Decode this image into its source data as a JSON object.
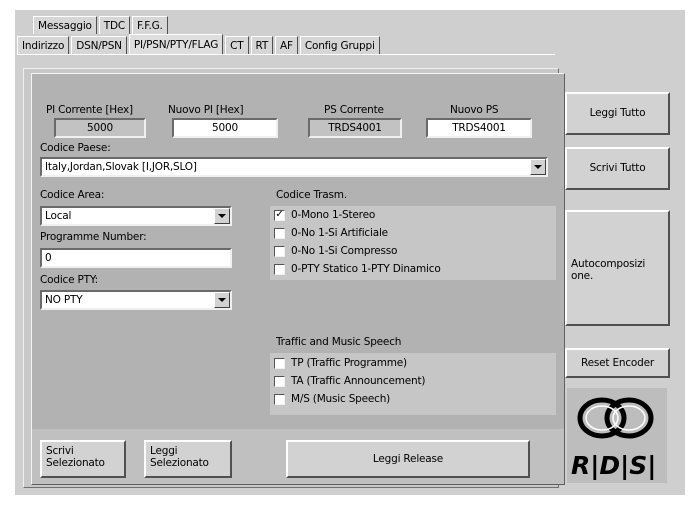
{
  "tabs_row1": [
    {
      "label": "Messaggio",
      "active": false
    },
    {
      "label": "TDC",
      "active": false
    },
    {
      "label": "F.F.G.",
      "active": false
    }
  ],
  "tabs_row2": [
    {
      "label": "Indirizzo",
      "active": false
    },
    {
      "label": "DSN/PSN",
      "active": false
    },
    {
      "label": "PI/PSN/PTY/FLAG",
      "active": true
    },
    {
      "label": "CT",
      "active": false
    },
    {
      "label": "RT",
      "active": false
    },
    {
      "label": "AF",
      "active": false
    },
    {
      "label": "Config Gruppi",
      "active": false
    }
  ],
  "pi_corrente": {
    "label": "PI Corrente [Hex]",
    "value": "5000"
  },
  "nuovo_pi": {
    "label": "Nuovo PI [Hex]",
    "value": "5000"
  },
  "ps_corrente": {
    "label": "PS Corrente",
    "value": "TRDS4001"
  },
  "nuovo_ps": {
    "label": "Nuovo PS",
    "value": "TRDS4001"
  },
  "codice_paese": {
    "label": "Codice Paese:",
    "value": "Italy,Jordan,Slovak [I,JOR,SLO]"
  },
  "codice_area": {
    "label": "Codice Area:",
    "value": "Local"
  },
  "program_number": {
    "label": "Programme Number:",
    "value": "0"
  },
  "codice_pty": {
    "label": "Codice PTY:",
    "value": "NO PTY"
  },
  "codice_trasm": {
    "label": "Codice Trasm.",
    "items": [
      {
        "label": "0-Mono 1-Stereo",
        "checked": true,
        "mark": "✓"
      },
      {
        "label": "0-No 1-Si Artificiale",
        "checked": false,
        "mark": ""
      },
      {
        "label": "0-No 1-Si Compresso",
        "checked": false,
        "mark": ""
      },
      {
        "label": "0-PTY Statico 1-PTY Dinamico",
        "checked": false,
        "mark": ""
      }
    ]
  },
  "traffic": {
    "label": "Traffic and Music Speech",
    "items": [
      {
        "label": "TP (Traffic Programme)",
        "checked": false,
        "mark": ""
      },
      {
        "label": "TA (Traffic Announcement)",
        "checked": false,
        "mark": ""
      },
      {
        "label": "M/S (Music Speech)",
        "checked": false,
        "mark": ""
      }
    ]
  },
  "buttons": {
    "scrivi_selezionato": "Scrivi\nSelezionato",
    "leggi_selezionato": "Leggi\nSelezionato",
    "leggi_release": "Leggi Release",
    "leggi_tutto": "Leggi Tutto",
    "scrivi_tutto": "Scrivi Tutto",
    "autocomposizione": "Autocomposizi\none.",
    "reset_encoder": "Reset Encoder"
  },
  "logo_text": "RIDSI",
  "colors": {
    "window_bg": "#cfcfcf",
    "page_bg": "#b2b2b2",
    "group_bg": "#c6c6c6"
  }
}
